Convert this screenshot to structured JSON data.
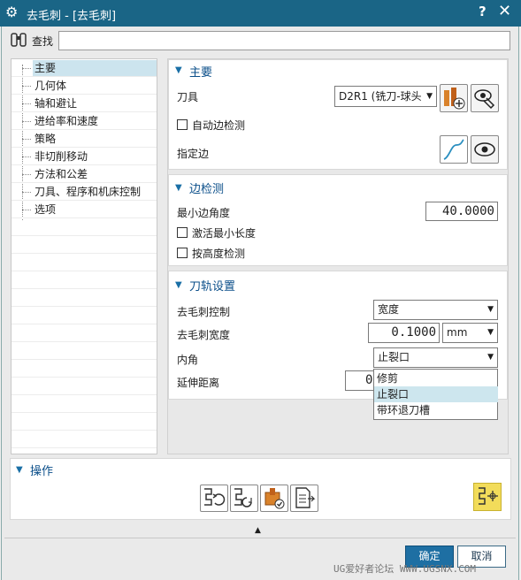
{
  "window": {
    "title": "去毛刺 - [去毛刺]",
    "help": "?",
    "close": "✕"
  },
  "find": {
    "label": "查找",
    "value": ""
  },
  "tree": {
    "items": [
      "主要",
      "几何体",
      "轴和避让",
      "进给率和速度",
      "策略",
      "非切削移动",
      "方法和公差",
      "刀具、程序和机床控制",
      "选项"
    ]
  },
  "main": {
    "title": "主要",
    "tool_label": "刀具",
    "tool_value": "D2R1 (铣刀-球头",
    "auto_edge_label": "自动边检测",
    "specify_edge_label": "指定边"
  },
  "edge": {
    "title": "边检测",
    "min_angle_label": "最小边角度",
    "min_angle_value": "40.0000",
    "activate_min_len_label": "激活最小长度",
    "height_detect_label": "按高度检测"
  },
  "toolpath": {
    "title": "刀轨设置",
    "deburr_control_label": "去毛刺控制",
    "deburr_control_value": "宽度",
    "deburr_width_label": "去毛刺宽度",
    "deburr_width_value": "0.1000",
    "unit_value": "mm",
    "inner_corner_label": "内角",
    "inner_corner_value": "止裂口",
    "extend_dist_label": "延伸距离",
    "extend_dist_value": "0",
    "dropdown_options": [
      "修剪",
      "止裂口",
      "带环退刀槽"
    ]
  },
  "actions": {
    "title": "操作"
  },
  "buttons": {
    "ok": "确定",
    "cancel": "取消"
  },
  "watermark": "UG爱好者论坛 WWW.UGSNX.COM",
  "colors": {
    "titlebar": "#1a6586",
    "accent": "#0b4f8a",
    "selected": "#cce4ee",
    "dropdown_highlight": "#cde6ee",
    "generate_icon_bg": "#f2dc5a"
  }
}
